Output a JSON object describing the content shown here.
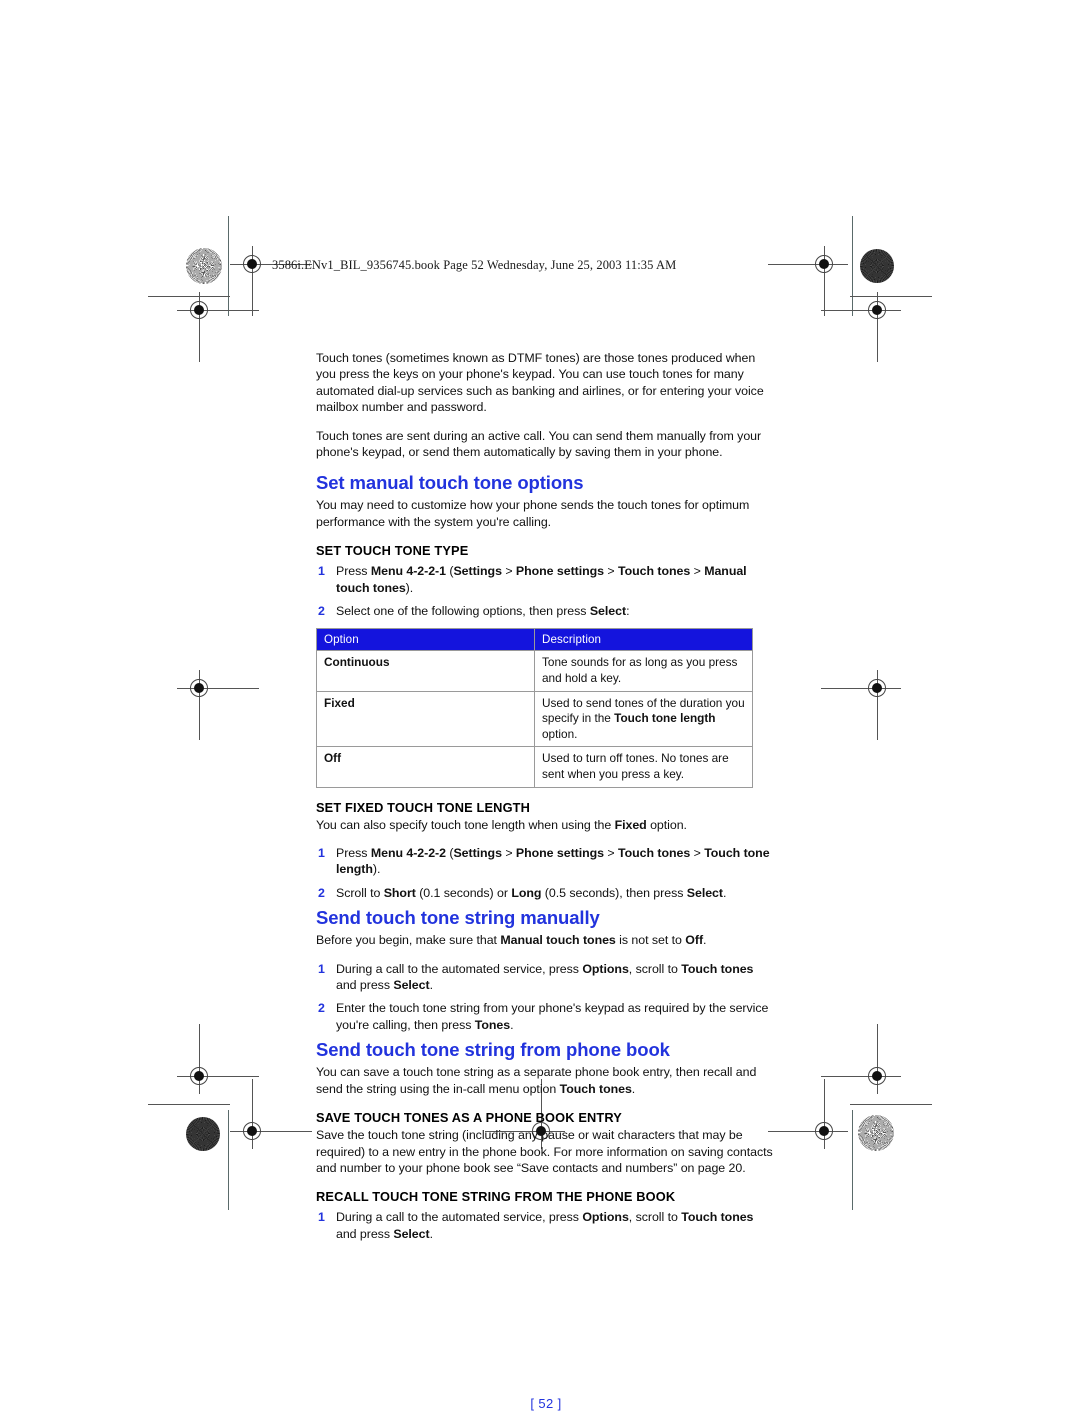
{
  "page": {
    "file_header": "3586i.ENv1_BIL_9356745.book  Page 52  Wednesday, June 25, 2003  11:35 AM",
    "page_number": "[ 52 ]",
    "accent_blue": "#2233dd",
    "table_header_blue": "#1414dd"
  },
  "intro": {
    "para1": "Touch tones (sometimes known as DTMF tones) are those tones produced when you press the keys on your phone's keypad. You can use touch tones for many automated dial-up services such as banking and airlines, or for entering your voice mailbox number and password.",
    "para2": "Touch tones are sent during an active call. You can send them manually from your phone's keypad, or send them automatically by saving them in your phone."
  },
  "section1": {
    "title": "Set manual touch tone options",
    "intro": "You may need to customize how your phone sends the touch tones for optimum performance with the system you're calling.",
    "sub1_title": "SET TOUCH TONE TYPE",
    "step1_num": "1",
    "step1_a": "Press ",
    "step1_b": "Menu 4-2-2-1 ",
    "step1_c": "(",
    "step1_d": "Settings",
    "step1_e": " > ",
    "step1_f": "Phone settings",
    "step1_g": " > ",
    "step1_h": "Touch tones",
    "step1_i": " > ",
    "step1_j": "Manual touch tones",
    "step1_k": ").",
    "step2_num": "2",
    "step2_a": "Select one of the following options, then press ",
    "step2_b": "Select",
    "step2_c": ":",
    "table": {
      "headers": [
        "Option",
        "Description"
      ],
      "rows": [
        {
          "option": "Continuous",
          "desc_a": "Tone sounds for as long as you press and hold a key.",
          "desc_b": "",
          "desc_c": ""
        },
        {
          "option": "Fixed",
          "desc_a": "Used to send tones of the duration you specify in the ",
          "desc_b": "Touch tone length",
          "desc_c": " option."
        },
        {
          "option": "Off",
          "desc_a": "Used to turn off tones. No tones are sent when you press a key.",
          "desc_b": "",
          "desc_c": ""
        }
      ]
    },
    "sub2_title": "SET FIXED TOUCH TONE LENGTH",
    "sub2_intro_a": "You can also specify touch tone length when using the ",
    "sub2_intro_b": "Fixed",
    "sub2_intro_c": " option.",
    "sub2_step1_num": "1",
    "sub2_step1_a": "Press ",
    "sub2_step1_b": "Menu 4-2-2-2 ",
    "sub2_step1_c": "(",
    "sub2_step1_d": "Settings",
    "sub2_step1_e": " > ",
    "sub2_step1_f": "Phone settings",
    "sub2_step1_g": " > ",
    "sub2_step1_h": "Touch tones",
    "sub2_step1_i": " > ",
    "sub2_step1_j": "Touch tone length",
    "sub2_step1_k": ").",
    "sub2_step2_num": "2",
    "sub2_step2_a": "Scroll to ",
    "sub2_step2_b": "Short",
    "sub2_step2_c": " (0.1 seconds) or ",
    "sub2_step2_d": "Long",
    "sub2_step2_e": " (0.5 seconds), then press ",
    "sub2_step2_f": "Select",
    "sub2_step2_g": "."
  },
  "section2": {
    "title": "Send touch tone string manually",
    "intro_a": "Before you begin, make sure that ",
    "intro_b": "Manual touch tones",
    "intro_c": " is not set to ",
    "intro_d": "Off",
    "intro_e": ".",
    "step1_num": "1",
    "step1_a": "During a call to the automated service, press ",
    "step1_b": "Options",
    "step1_c": ", scroll to ",
    "step1_d": "Touch tones",
    "step1_e": " and press ",
    "step1_f": "Select",
    "step1_g": ".",
    "step2_num": "2",
    "step2_a": "Enter the touch tone string from your phone's keypad as required by the service you're calling, then press ",
    "step2_b": "Tones",
    "step2_c": "."
  },
  "section3": {
    "title": "Send touch tone string from phone book",
    "intro_a": "You can save a touch tone string as a separate phone book entry, then recall and send the string using the in-call menu option ",
    "intro_b": "Touch tones",
    "intro_c": ".",
    "sub1_title": "SAVE TOUCH TONES AS A PHONE BOOK ENTRY",
    "sub1_body": "Save the touch tone string (including any pause or wait characters that may be required) to a new entry in the phone book. For more information on saving contacts and number to your phone book see “Save contacts and numbers” on page 20.",
    "sub2_title": "RECALL TOUCH TONE STRING FROM THE PHONE BOOK",
    "sub2_step1_num": "1",
    "sub2_step1_a": "During a call to the automated service, press ",
    "sub2_step1_b": "Options",
    "sub2_step1_c": ", scroll to ",
    "sub2_step1_d": "Touch tones",
    "sub2_step1_e": " and press ",
    "sub2_step1_f": "Select",
    "sub2_step1_g": "."
  }
}
